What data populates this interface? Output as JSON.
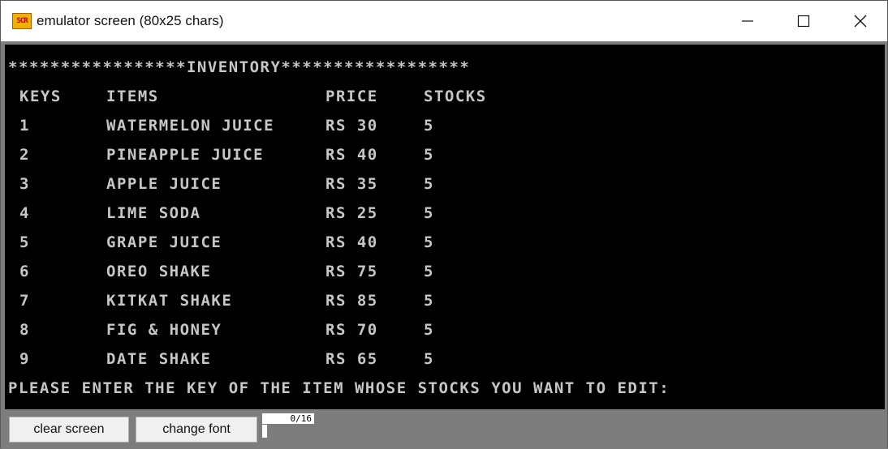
{
  "window": {
    "title": "emulator screen (80x25 chars)",
    "icon_label": "SCR",
    "controls": [
      "minimize-icon",
      "maximize-icon",
      "close-icon"
    ]
  },
  "screen": {
    "banner": "*****************INVENTORY******************",
    "headers": [
      "KEYS",
      "ITEMS",
      "PRICE",
      "STOCKS"
    ],
    "rows": [
      {
        "key": "1",
        "item": "WATERMELON JUICE",
        "price": "RS 30",
        "stock": "5"
      },
      {
        "key": "2",
        "item": "PINEAPPLE JUICE",
        "price": "RS 40",
        "stock": "5"
      },
      {
        "key": "3",
        "item": "APPLE JUICE",
        "price": "RS 35",
        "stock": "5"
      },
      {
        "key": "4",
        "item": "LIME SODA",
        "price": "RS 25",
        "stock": "5"
      },
      {
        "key": "5",
        "item": "GRAPE JUICE",
        "price": "RS 40",
        "stock": "5"
      },
      {
        "key": "6",
        "item": "OREO SHAKE",
        "price": "RS 75",
        "stock": "5"
      },
      {
        "key": "7",
        "item": "KITKAT SHAKE",
        "price": "RS 85",
        "stock": "5"
      },
      {
        "key": "8",
        "item": "FIG & HONEY",
        "price": "RS 70",
        "stock": "5"
      },
      {
        "key": "9",
        "item": "DATE SHAKE",
        "price": "RS 65",
        "stock": "5"
      }
    ],
    "prompt": "PLEASE ENTER THE KEY OF THE ITEM WHOSE STOCKS YOU WANT TO EDIT:"
  },
  "toolbar": {
    "clear_label": "clear screen",
    "font_label": "change font",
    "counter": "0/16"
  },
  "colors": {
    "screen_bg": "#000000",
    "screen_text": "#c6c6c6",
    "frame": "#7d7d7d"
  }
}
